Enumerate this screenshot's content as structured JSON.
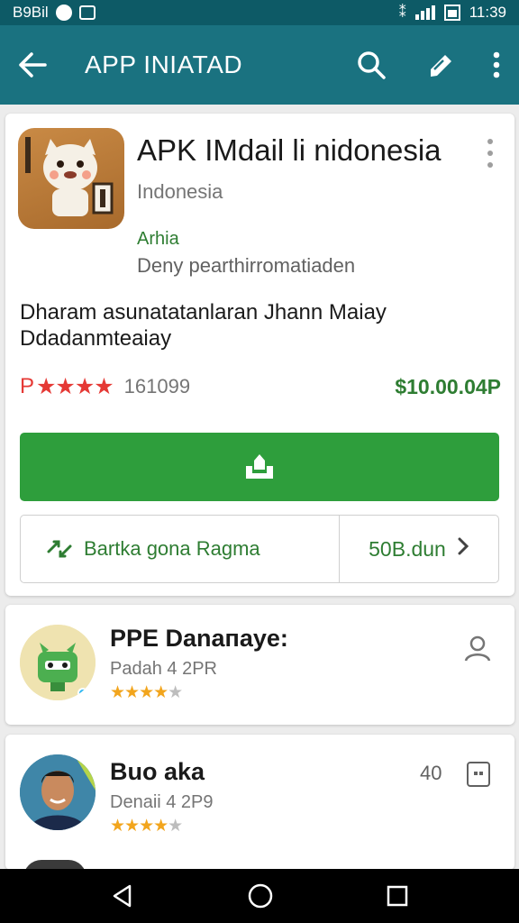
{
  "status_bar": {
    "left_text": "B9Bil",
    "time": "11:39"
  },
  "app_bar": {
    "title": "APP INIATAD",
    "back_icon": "arrow-back-icon",
    "search_icon": "search-icon",
    "edit_icon": "edit-icon",
    "more_icon": "more-vert-icon",
    "background": "#1a7280"
  },
  "app_detail": {
    "title": "APK IMdail li nidonesia",
    "subtitle": "Indonesia",
    "developer": "Arhia",
    "note": "Deny pearthirromatiaden",
    "description": "Dharam asunatatanlaran Jhann Maiay Ddadanmteaiay",
    "rating_prefix": "P",
    "stars": "★★★★",
    "rating_count": "161099",
    "price": "$10.00.04P",
    "install_icon": "install-icon",
    "secondary_left_label": "Bartka gona Ragma",
    "secondary_right_label": "50B.dun",
    "accent_green": "#2e9e3c"
  },
  "list_items": [
    {
      "title": "PPE Danaпаye:",
      "subtitle": "Padah 4 2PR",
      "stars_on": "★★★★",
      "stars_half": "★",
      "action_icon": "person-icon"
    },
    {
      "title": "Buo aka",
      "subtitle": "Denaii 4 2P9",
      "stars_on": "★★★★",
      "stars_off": "★",
      "meta": "40",
      "action_icon": "box-icon"
    }
  ],
  "nav_bar": {
    "back": "nav-back-icon",
    "home": "nav-home-icon",
    "recents": "nav-recents-icon"
  }
}
